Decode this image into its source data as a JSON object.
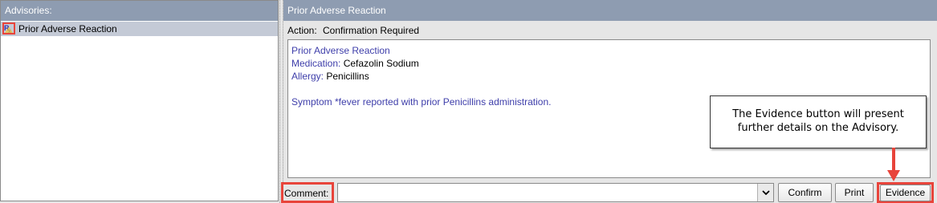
{
  "advisories": {
    "header": "Advisories:",
    "items": [
      {
        "icon": "rx-icon",
        "label": "Prior Adverse Reaction"
      }
    ]
  },
  "detail": {
    "header": "Prior Adverse Reaction",
    "action_label": "Action:",
    "action_value": "Confirmation Required",
    "title": "Prior Adverse Reaction",
    "medication_label": "Medication:",
    "medication_value": "Cefazolin Sodium",
    "allergy_label": "Allergy:",
    "allergy_value": "Penicillins",
    "symptom": "Symptom *fever reported with prior Penicillins administration."
  },
  "footer": {
    "comment_label": "Comment:",
    "comment_value": "",
    "confirm_label": "Confirm",
    "print_label": "Print",
    "evidence_label": "Evidence"
  },
  "callout": {
    "line1": "The Evidence button will present",
    "line2": "further details on the Advisory."
  },
  "colors": {
    "header_bg": "#8e9cb1",
    "selected_row": "#c4cad6",
    "highlight_red": "#e8443b",
    "detail_blue": "#3e3eaa"
  }
}
